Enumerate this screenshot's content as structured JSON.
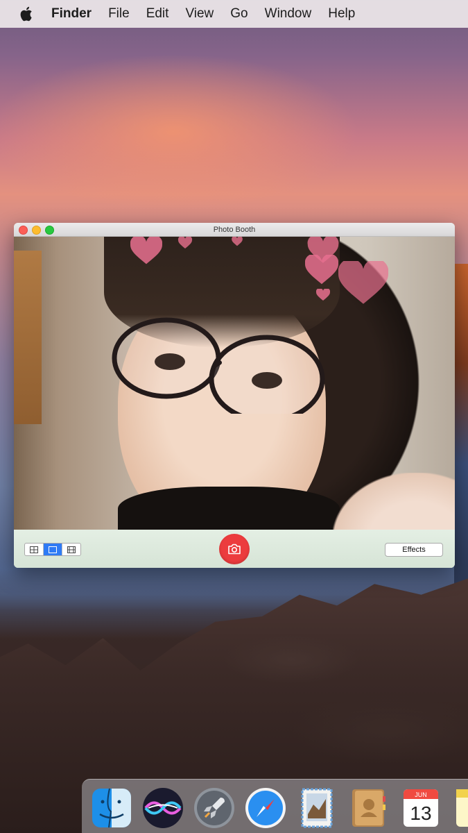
{
  "menubar": {
    "apple_icon": "apple-logo-icon",
    "items": [
      "Finder",
      "File",
      "Edit",
      "View",
      "Go",
      "Window",
      "Help"
    ]
  },
  "window": {
    "title": "Photo Booth",
    "controls": {
      "view_modes": [
        "grid-view-icon",
        "single-view-icon",
        "filmstrip-view-icon"
      ],
      "selected_view": "single-view-icon",
      "shutter_icon": "camera-icon",
      "effects_label": "Effects"
    }
  },
  "dock": {
    "apps": [
      "Finder",
      "Siri",
      "Launchpad",
      "Safari",
      "Mail",
      "Contacts",
      "Calendar",
      "Notes"
    ],
    "calendar_month": "JUN",
    "calendar_day": "13"
  },
  "colors": {
    "shutter": "#ec3c3e",
    "selected_toggle": "#2f7bf5",
    "window_chrome": "#dfeae0"
  }
}
